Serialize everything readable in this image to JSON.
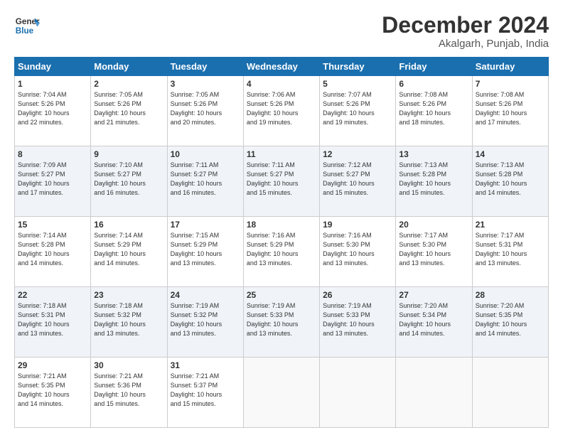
{
  "logo": {
    "line1": "General",
    "line2": "Blue"
  },
  "title": "December 2024",
  "location": "Akalgarh, Punjab, India",
  "days_of_week": [
    "Sunday",
    "Monday",
    "Tuesday",
    "Wednesday",
    "Thursday",
    "Friday",
    "Saturday"
  ],
  "weeks": [
    [
      {
        "day": "1",
        "info": "Sunrise: 7:04 AM\nSunset: 5:26 PM\nDaylight: 10 hours\nand 22 minutes."
      },
      {
        "day": "2",
        "info": "Sunrise: 7:05 AM\nSunset: 5:26 PM\nDaylight: 10 hours\nand 21 minutes."
      },
      {
        "day": "3",
        "info": "Sunrise: 7:05 AM\nSunset: 5:26 PM\nDaylight: 10 hours\nand 20 minutes."
      },
      {
        "day": "4",
        "info": "Sunrise: 7:06 AM\nSunset: 5:26 PM\nDaylight: 10 hours\nand 19 minutes."
      },
      {
        "day": "5",
        "info": "Sunrise: 7:07 AM\nSunset: 5:26 PM\nDaylight: 10 hours\nand 19 minutes."
      },
      {
        "day": "6",
        "info": "Sunrise: 7:08 AM\nSunset: 5:26 PM\nDaylight: 10 hours\nand 18 minutes."
      },
      {
        "day": "7",
        "info": "Sunrise: 7:08 AM\nSunset: 5:26 PM\nDaylight: 10 hours\nand 17 minutes."
      }
    ],
    [
      {
        "day": "8",
        "info": "Sunrise: 7:09 AM\nSunset: 5:27 PM\nDaylight: 10 hours\nand 17 minutes."
      },
      {
        "day": "9",
        "info": "Sunrise: 7:10 AM\nSunset: 5:27 PM\nDaylight: 10 hours\nand 16 minutes."
      },
      {
        "day": "10",
        "info": "Sunrise: 7:11 AM\nSunset: 5:27 PM\nDaylight: 10 hours\nand 16 minutes."
      },
      {
        "day": "11",
        "info": "Sunrise: 7:11 AM\nSunset: 5:27 PM\nDaylight: 10 hours\nand 15 minutes."
      },
      {
        "day": "12",
        "info": "Sunrise: 7:12 AM\nSunset: 5:27 PM\nDaylight: 10 hours\nand 15 minutes."
      },
      {
        "day": "13",
        "info": "Sunrise: 7:13 AM\nSunset: 5:28 PM\nDaylight: 10 hours\nand 15 minutes."
      },
      {
        "day": "14",
        "info": "Sunrise: 7:13 AM\nSunset: 5:28 PM\nDaylight: 10 hours\nand 14 minutes."
      }
    ],
    [
      {
        "day": "15",
        "info": "Sunrise: 7:14 AM\nSunset: 5:28 PM\nDaylight: 10 hours\nand 14 minutes."
      },
      {
        "day": "16",
        "info": "Sunrise: 7:14 AM\nSunset: 5:29 PM\nDaylight: 10 hours\nand 14 minutes."
      },
      {
        "day": "17",
        "info": "Sunrise: 7:15 AM\nSunset: 5:29 PM\nDaylight: 10 hours\nand 13 minutes."
      },
      {
        "day": "18",
        "info": "Sunrise: 7:16 AM\nSunset: 5:29 PM\nDaylight: 10 hours\nand 13 minutes."
      },
      {
        "day": "19",
        "info": "Sunrise: 7:16 AM\nSunset: 5:30 PM\nDaylight: 10 hours\nand 13 minutes."
      },
      {
        "day": "20",
        "info": "Sunrise: 7:17 AM\nSunset: 5:30 PM\nDaylight: 10 hours\nand 13 minutes."
      },
      {
        "day": "21",
        "info": "Sunrise: 7:17 AM\nSunset: 5:31 PM\nDaylight: 10 hours\nand 13 minutes."
      }
    ],
    [
      {
        "day": "22",
        "info": "Sunrise: 7:18 AM\nSunset: 5:31 PM\nDaylight: 10 hours\nand 13 minutes."
      },
      {
        "day": "23",
        "info": "Sunrise: 7:18 AM\nSunset: 5:32 PM\nDaylight: 10 hours\nand 13 minutes."
      },
      {
        "day": "24",
        "info": "Sunrise: 7:19 AM\nSunset: 5:32 PM\nDaylight: 10 hours\nand 13 minutes."
      },
      {
        "day": "25",
        "info": "Sunrise: 7:19 AM\nSunset: 5:33 PM\nDaylight: 10 hours\nand 13 minutes."
      },
      {
        "day": "26",
        "info": "Sunrise: 7:19 AM\nSunset: 5:33 PM\nDaylight: 10 hours\nand 13 minutes."
      },
      {
        "day": "27",
        "info": "Sunrise: 7:20 AM\nSunset: 5:34 PM\nDaylight: 10 hours\nand 14 minutes."
      },
      {
        "day": "28",
        "info": "Sunrise: 7:20 AM\nSunset: 5:35 PM\nDaylight: 10 hours\nand 14 minutes."
      }
    ],
    [
      {
        "day": "29",
        "info": "Sunrise: 7:21 AM\nSunset: 5:35 PM\nDaylight: 10 hours\nand 14 minutes."
      },
      {
        "day": "30",
        "info": "Sunrise: 7:21 AM\nSunset: 5:36 PM\nDaylight: 10 hours\nand 15 minutes."
      },
      {
        "day": "31",
        "info": "Sunrise: 7:21 AM\nSunset: 5:37 PM\nDaylight: 10 hours\nand 15 minutes."
      },
      {
        "day": "",
        "info": ""
      },
      {
        "day": "",
        "info": ""
      },
      {
        "day": "",
        "info": ""
      },
      {
        "day": "",
        "info": ""
      }
    ]
  ]
}
